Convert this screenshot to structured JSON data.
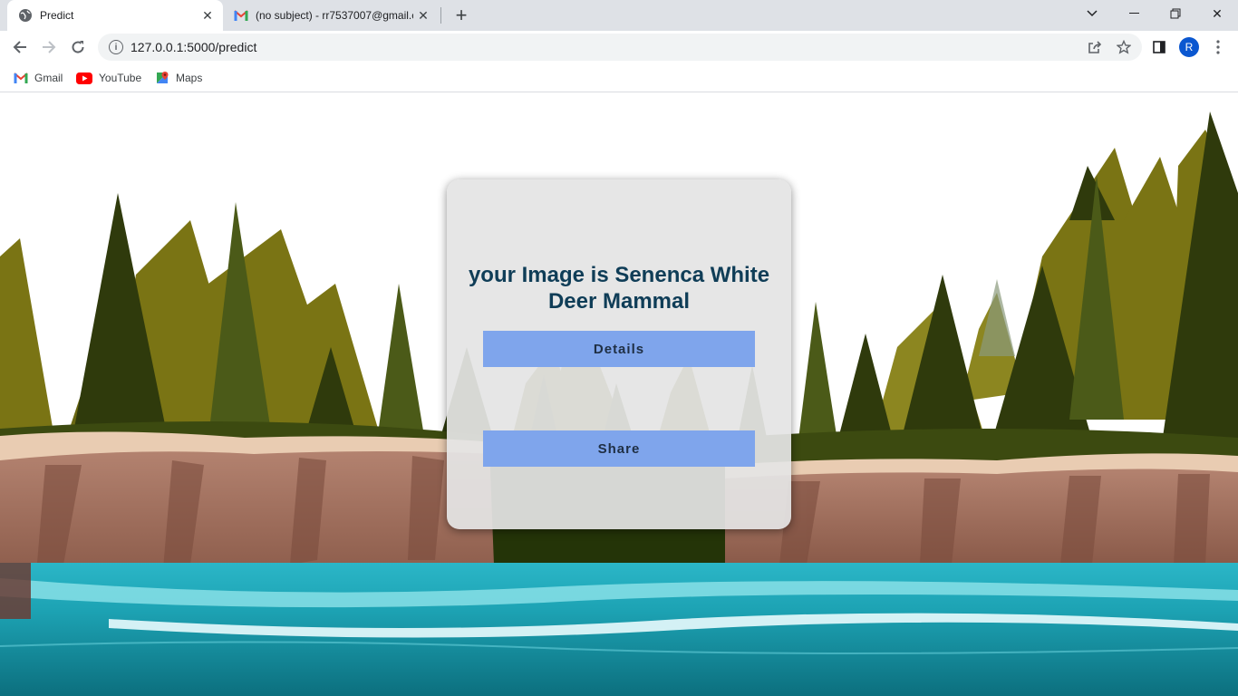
{
  "browser": {
    "tabs": [
      {
        "title": "Predict",
        "favicon": "globe-icon"
      },
      {
        "title": "(no subject) - rr7537007@gmail.c",
        "favicon": "gmail-icon"
      }
    ],
    "address_bar": {
      "url": "127.0.0.1:5000/predict"
    },
    "profile_initial": "R",
    "bookmarks": [
      {
        "label": "Gmail",
        "icon": "gmail-icon"
      },
      {
        "label": "YouTube",
        "icon": "youtube-icon"
      },
      {
        "label": "Maps",
        "icon": "maps-icon"
      }
    ]
  },
  "page": {
    "result_title": "your Image is Senenca White Deer Mammal",
    "details_label": "Details",
    "share_label": "Share"
  }
}
